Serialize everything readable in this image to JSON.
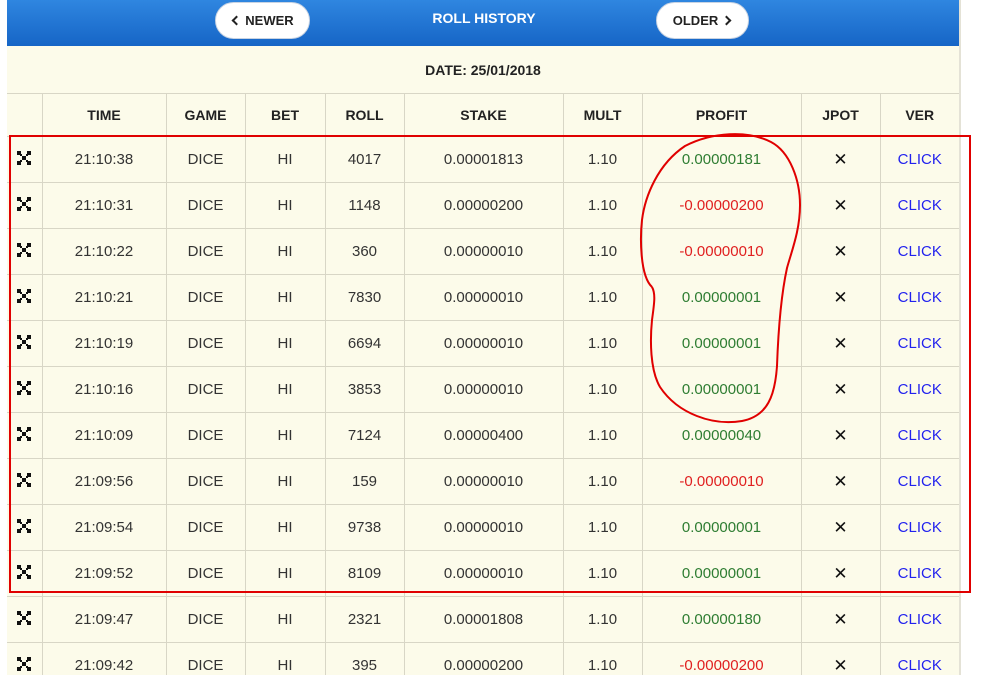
{
  "header": {
    "title": "ROLL HISTORY",
    "newer_label": "NEWER",
    "older_label": "OLDER"
  },
  "date_label": "DATE: 25/01/2018",
  "columns": [
    "TIME",
    "GAME",
    "BET",
    "ROLL",
    "STAKE",
    "MULT",
    "PROFIT",
    "JPOT",
    "VER"
  ],
  "rows": [
    {
      "time": "21:10:38",
      "game": "DICE",
      "bet": "HI",
      "roll": "4017",
      "stake": "0.00001813",
      "mult": "1.10",
      "profit": "0.00000181",
      "jpot": "✕",
      "ver": "CLICK",
      "sign": "pos"
    },
    {
      "time": "21:10:31",
      "game": "DICE",
      "bet": "HI",
      "roll": "1148",
      "stake": "0.00000200",
      "mult": "1.10",
      "profit": "-0.00000200",
      "jpot": "✕",
      "ver": "CLICK",
      "sign": "neg"
    },
    {
      "time": "21:10:22",
      "game": "DICE",
      "bet": "HI",
      "roll": "360",
      "stake": "0.00000010",
      "mult": "1.10",
      "profit": "-0.00000010",
      "jpot": "✕",
      "ver": "CLICK",
      "sign": "neg"
    },
    {
      "time": "21:10:21",
      "game": "DICE",
      "bet": "HI",
      "roll": "7830",
      "stake": "0.00000010",
      "mult": "1.10",
      "profit": "0.00000001",
      "jpot": "✕",
      "ver": "CLICK",
      "sign": "pos"
    },
    {
      "time": "21:10:19",
      "game": "DICE",
      "bet": "HI",
      "roll": "6694",
      "stake": "0.00000010",
      "mult": "1.10",
      "profit": "0.00000001",
      "jpot": "✕",
      "ver": "CLICK",
      "sign": "pos"
    },
    {
      "time": "21:10:16",
      "game": "DICE",
      "bet": "HI",
      "roll": "3853",
      "stake": "0.00000010",
      "mult": "1.10",
      "profit": "0.00000001",
      "jpot": "✕",
      "ver": "CLICK",
      "sign": "pos"
    },
    {
      "time": "21:10:09",
      "game": "DICE",
      "bet": "HI",
      "roll": "7124",
      "stake": "0.00000400",
      "mult": "1.10",
      "profit": "0.00000040",
      "jpot": "✕",
      "ver": "CLICK",
      "sign": "pos"
    },
    {
      "time": "21:09:56",
      "game": "DICE",
      "bet": "HI",
      "roll": "159",
      "stake": "0.00000010",
      "mult": "1.10",
      "profit": "-0.00000010",
      "jpot": "✕",
      "ver": "CLICK",
      "sign": "neg"
    },
    {
      "time": "21:09:54",
      "game": "DICE",
      "bet": "HI",
      "roll": "9738",
      "stake": "0.00000010",
      "mult": "1.10",
      "profit": "0.00000001",
      "jpot": "✕",
      "ver": "CLICK",
      "sign": "pos"
    },
    {
      "time": "21:09:52",
      "game": "DICE",
      "bet": "HI",
      "roll": "8109",
      "stake": "0.00000010",
      "mult": "1.10",
      "profit": "0.00000001",
      "jpot": "✕",
      "ver": "CLICK",
      "sign": "pos"
    },
    {
      "time": "21:09:47",
      "game": "DICE",
      "bet": "HI",
      "roll": "2321",
      "stake": "0.00001808",
      "mult": "1.10",
      "profit": "0.00000180",
      "jpot": "✕",
      "ver": "CLICK",
      "sign": "pos"
    },
    {
      "time": "21:09:42",
      "game": "DICE",
      "bet": "HI",
      "roll": "395",
      "stake": "0.00000200",
      "mult": "1.10",
      "profit": "-0.00000200",
      "jpot": "✕",
      "ver": "CLICK",
      "sign": "neg"
    }
  ],
  "colors": {
    "header": "#1e74d6",
    "panel": "#fcfbea",
    "profit_positive": "#2e7d32",
    "profit_negative": "#e02020",
    "link": "#2222ee",
    "annotation": "#e00000"
  },
  "icons": {
    "row_icon": "dice-grid-icon",
    "jackpot": "close-icon"
  }
}
